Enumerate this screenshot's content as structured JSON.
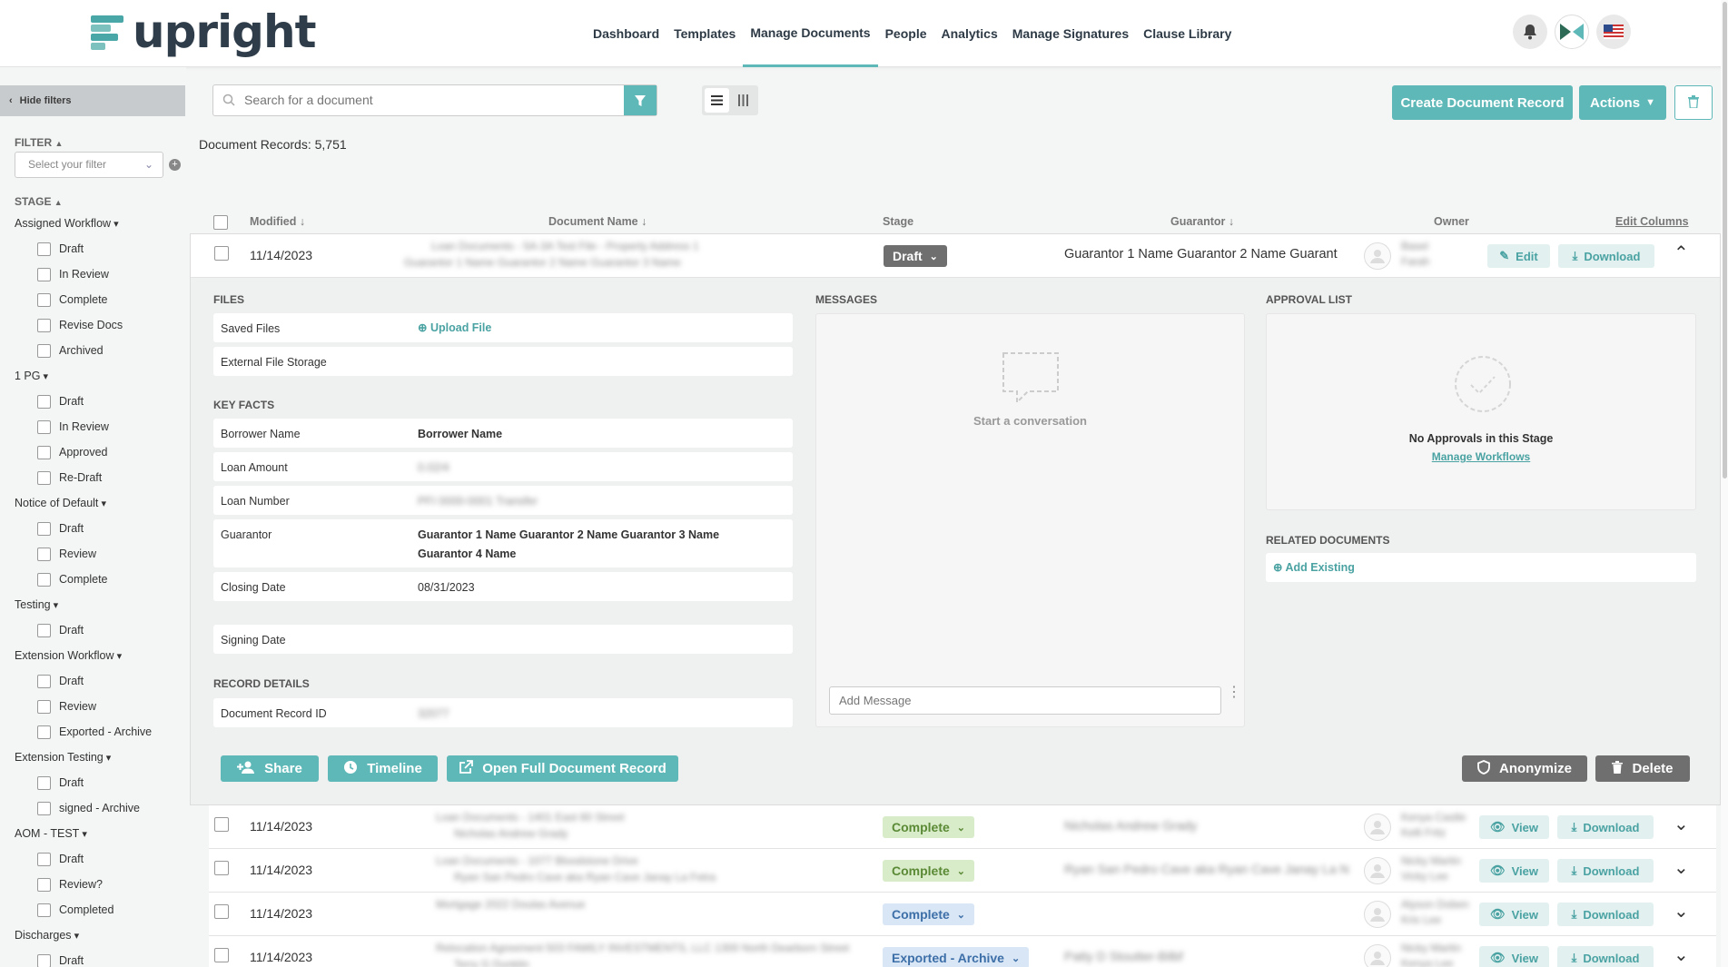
{
  "brand": {
    "name": "upright"
  },
  "nav": [
    {
      "label": "Dashboard"
    },
    {
      "label": "Templates"
    },
    {
      "label": "Manage Documents"
    },
    {
      "label": "People"
    },
    {
      "label": "Analytics"
    },
    {
      "label": "Manage Signatures"
    },
    {
      "label": "Clause Library"
    }
  ],
  "sidebar": {
    "hide_filters": "Hide filters",
    "filter_label": "FILTER",
    "filter_placeholder": "Select your filter",
    "stage_label": "STAGE",
    "groups": [
      {
        "name": "Assigned Workflow",
        "options": [
          "Draft",
          "In Review",
          "Complete",
          "Revise Docs",
          "Archived"
        ]
      },
      {
        "name": "1 PG",
        "options": [
          "Draft",
          "In Review",
          "Approved",
          "Re-Draft"
        ]
      },
      {
        "name": "Notice of Default",
        "options": [
          "Draft",
          "Review",
          "Complete"
        ]
      },
      {
        "name": "Testing",
        "options": [
          "Draft"
        ]
      },
      {
        "name": "Extension Workflow",
        "options": [
          "Draft",
          "Review",
          "Exported - Archive"
        ]
      },
      {
        "name": "Extension Testing",
        "options": [
          "Draft",
          "signed - Archive"
        ]
      },
      {
        "name": "AOM - TEST",
        "options": [
          "Draft",
          "Review?",
          "Completed"
        ]
      },
      {
        "name": "Discharges",
        "options": [
          "Draft"
        ]
      }
    ]
  },
  "toolbar": {
    "search_placeholder": "Search for a document",
    "create_label": "Create Document Record",
    "actions_label": "Actions"
  },
  "record_count": "Document Records: 5,751",
  "table": {
    "headers": {
      "modified": "Modified",
      "document_name": "Document Name",
      "stage": "Stage",
      "guarantor": "Guarantor",
      "owner": "Owner",
      "edit_columns": "Edit Columns"
    }
  },
  "expanded": {
    "modified": "11/14/2023",
    "document_name_line1": "Loan Documents - 5A-3A Test File - Property Address 1",
    "document_name_line2": "Guarantor 1 Name Guarantor 2 Name Guarantor 3 Name",
    "stage": "Draft",
    "guarantor": "Guarantor 1 Name Guarantor 2 Name Guarant",
    "owner_line1": "Basel",
    "owner_line2": "Farah",
    "edit_label": "Edit",
    "download_label": "Download",
    "files_title": "FILES",
    "saved_files": "Saved Files",
    "upload_file": "Upload File",
    "external_storage": "External File Storage",
    "key_facts_title": "KEY FACTS",
    "key_facts": [
      {
        "key": "Borrower Name",
        "value": "Borrower Name"
      },
      {
        "key": "Loan Amount",
        "value": "0.02/4"
      },
      {
        "key": "Loan Number",
        "value": "PFI 0000-0001 Transfer"
      },
      {
        "key": "Guarantor",
        "value": "Guarantor 1 Name Guarantor 2 Name Guarantor 3 Name",
        "value2": "Guarantor 4 Name"
      },
      {
        "key": "Closing Date",
        "value": "08/31/2023"
      },
      {
        "key": "Signing Date",
        "value": ""
      }
    ],
    "record_details_title": "RECORD DETAILS",
    "record_id_label": "Document Record ID",
    "record_id_value": "32077",
    "messages_title": "MESSAGES",
    "start_conversation": "Start a conversation",
    "add_message_placeholder": "Add Message",
    "approval_title": "APPROVAL LIST",
    "no_approvals": "No Approvals in this Stage",
    "manage_workflows": "Manage Workflows",
    "related_title": "RELATED DOCUMENTS",
    "add_existing": "Add Existing",
    "share_label": "Share",
    "timeline_label": "Timeline",
    "open_full_label": "Open Full Document Record",
    "anonymize_label": "Anonymize",
    "delete_label": "Delete"
  },
  "rows": [
    {
      "modified": "11/14/2023",
      "name1": "Loan Documents - 1401 East 60 Street",
      "name2": "Nicholas Andrew Grady",
      "stage": "Complete",
      "stage_color": "#d9ecc9",
      "stage_text": "#5b8a36",
      "guarantor": "Nicholas Andrew Grady",
      "owner1": "Kenya Castle",
      "owner2": "Kelli Fritz"
    },
    {
      "modified": "11/14/2023",
      "name1": "Loan Documents - 1077 Bloodstone Drive",
      "name2": "Ryan San Pedro Cave aka Ryan Cave Janay La Fetra",
      "stage": "Complete",
      "stage_color": "#d9ecc9",
      "stage_text": "#5b8a36",
      "guarantor": "Ryan San Pedro Cave aka Ryan Cave Janay La N",
      "owner1": "Nicky Martin",
      "owner2": "Vicky Lee"
    },
    {
      "modified": "11/14/2023",
      "name1": "Mortgage 2022 Doulas Avenue",
      "name2": "",
      "stage": "Complete",
      "stage_color": "#d9e6f5",
      "stage_text": "#3d6fa8",
      "guarantor": "",
      "owner1": "Alyson Doben",
      "owner2": "Kris Lee"
    },
    {
      "modified": "11/14/2023",
      "name1": "Relocation Agreement 503 FAMILY INVESTMENTS, LLC 1300 North Dearborn Street",
      "name2": "Terry G Dunklin",
      "stage": "Exported - Archive",
      "stage_color": "#d9e6f5",
      "stage_text": "#3d6fa8",
      "guarantor": "Patty D Stoutter-Bilbf",
      "owner1": "Nicky Martin",
      "owner2": "Kenya Lee"
    }
  ],
  "row_view_label": "View",
  "row_download_label": "Download",
  "colors": {
    "accent": "#5fb8b8",
    "brand_dark": "#2f3d4a"
  }
}
